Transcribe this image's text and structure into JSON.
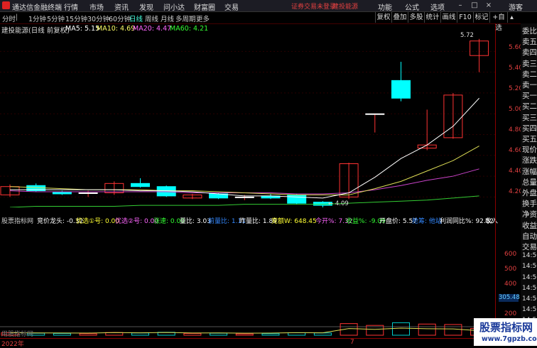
{
  "app": {
    "title": "通达信金融终端",
    "menus": [
      "行情",
      "市场",
      "资讯",
      "发现",
      "问小达",
      "财富圈",
      "交易"
    ],
    "warning": "证券交易未登录",
    "stock_link": "建投能源",
    "right_menus": [
      "功能",
      "公式",
      "选项"
    ],
    "guest": "游客"
  },
  "period_tabs": [
    "分时",
    "1分钟",
    "5分钟",
    "15分钟",
    "30分钟",
    "60分钟",
    "日线",
    "周线",
    "月线",
    "多周期",
    "更多"
  ],
  "active_tab": "日线",
  "toolbar": [
    "复权",
    "叠加",
    "多股",
    "统计",
    "画线",
    "F10",
    "标记",
    "+自选"
  ],
  "chart_info": {
    "name": "建投能源(日线 前复权)",
    "ma": [
      {
        "label": "MA5: 5.15",
        "color": "#ffffff"
      },
      {
        "label": "MA10: 4.69",
        "color": "#ffff66"
      },
      {
        "label": "MA20: 4.47",
        "color": "#ff66ff"
      },
      {
        "label": "MA60: 4.21",
        "color": "#33ff33"
      }
    ]
  },
  "price_axis": [
    "5.60",
    "5.40",
    "5.20",
    "5.00",
    "4.80",
    "4.60",
    "4.40",
    "4.20"
  ],
  "volume_axis": [
    "600",
    "500",
    "400",
    "305.48",
    "200",
    "100"
  ],
  "annotations": {
    "high": "5.72",
    "low": "4.09"
  },
  "indicator_bar": [
    {
      "label": "股票指标网",
      "color": "#cccccc"
    },
    {
      "label": "竞价龙头: -0.32",
      "color": "#ffffff"
    },
    {
      "label": "优选①号: 0.00",
      "color": "#ffff33"
    },
    {
      "label": "优选②号: 0.00",
      "color": "#ff66ff"
    },
    {
      "label": "涨速: 0.00",
      "color": "#33ff33"
    },
    {
      "label": "量比: 3.03",
      "color": "#ffffff"
    },
    {
      "label": "前量比: 1.11",
      "color": "#3388ff"
    },
    {
      "label": "昨量比: 1.89",
      "color": "#ffffff"
    },
    {
      "label": "竞额W: 648.45",
      "color": "#ffff33"
    },
    {
      "label": "今开%: 7.32",
      "color": "#ff66ff"
    },
    {
      "label": "收益%: -9.09",
      "color": "#33ff33"
    },
    {
      "label": "开盘价: 5.57",
      "color": "#ffffff"
    },
    {
      "label": "抢筹: 他站",
      "color": "#3388ff"
    },
    {
      "label": "利润同比%: 92.52",
      "color": "#ffffff"
    },
    {
      "label": "收入",
      "color": "#ffffff"
    }
  ],
  "side_panel": [
    "委比",
    "卖五",
    "卖四",
    "卖三",
    "卖二",
    "卖一",
    "买一",
    "买二",
    "买三",
    "买四",
    "买五",
    "现价",
    "涨跌",
    "涨幅",
    "总量",
    "外盘",
    "换手",
    "净资",
    "收益",
    "自动",
    "交易",
    "14:50",
    "14:50",
    "14:50",
    "14:50",
    "14:50",
    "14:56",
    "14:56",
    "14:56"
  ],
  "time_axis": {
    "year": "2022年",
    "month": "7"
  },
  "watermark": {
    "left": "用股指标网",
    "title": "股票指标网",
    "url": "www.7gpzb.com"
  },
  "chart_data": {
    "type": "candlestick",
    "ylim": [
      4.1,
      5.78
    ],
    "candles": [
      {
        "open": 4.22,
        "close": 4.3,
        "high": 4.32,
        "low": 4.2,
        "vol": 110
      },
      {
        "open": 4.31,
        "close": 4.26,
        "high": 4.33,
        "low": 4.25,
        "vol": 90
      },
      {
        "open": 4.25,
        "close": 4.23,
        "high": 4.26,
        "low": 4.22,
        "vol": 80
      },
      {
        "open": 4.24,
        "close": 4.24,
        "high": 4.26,
        "low": 4.2,
        "vol": 70
      },
      {
        "open": 4.24,
        "close": 4.33,
        "high": 4.35,
        "low": 4.22,
        "vol": 120
      },
      {
        "open": 4.33,
        "close": 4.3,
        "high": 4.38,
        "low": 4.29,
        "vol": 100
      },
      {
        "open": 4.3,
        "close": 4.21,
        "high": 4.31,
        "low": 4.2,
        "vol": 130
      },
      {
        "open": 4.19,
        "close": 4.22,
        "high": 4.23,
        "low": 4.18,
        "vol": 80
      },
      {
        "open": 4.23,
        "close": 4.19,
        "high": 4.24,
        "low": 4.18,
        "vol": 90
      },
      {
        "open": 4.2,
        "close": 4.2,
        "high": 4.22,
        "low": 4.17,
        "vol": 60
      },
      {
        "open": 4.21,
        "close": 4.19,
        "high": 4.23,
        "low": 4.18,
        "vol": 70
      },
      {
        "open": 4.22,
        "close": 4.14,
        "high": 4.23,
        "low": 4.13,
        "vol": 110
      },
      {
        "open": 4.15,
        "close": 4.12,
        "high": 4.16,
        "low": 4.09,
        "vol": 100
      },
      {
        "open": 4.2,
        "close": 4.52,
        "high": 4.53,
        "low": 4.18,
        "vol": 520
      },
      {
        "open": 5.0,
        "close": 5.0,
        "high": 5.0,
        "low": 4.82,
        "vol": 440
      },
      {
        "open": 5.32,
        "close": 5.15,
        "high": 5.5,
        "low": 5.12,
        "vol": 560
      },
      {
        "open": 4.67,
        "close": 4.7,
        "high": 5.04,
        "low": 4.65,
        "vol": 500
      },
      {
        "open": 4.77,
        "close": 5.18,
        "high": 5.2,
        "low": 4.76,
        "vol": 480
      },
      {
        "open": 5.56,
        "close": 5.7,
        "high": 5.72,
        "low": 5.4,
        "vol": 305
      }
    ],
    "ma5": [
      4.27,
      4.27,
      4.27,
      4.27,
      4.27,
      4.26,
      4.26,
      4.25,
      4.23,
      4.21,
      4.21,
      4.2,
      4.19,
      4.24,
      4.39,
      4.57,
      4.7,
      4.88,
      5.15
    ],
    "ma10": [
      4.3,
      4.29,
      4.28,
      4.27,
      4.27,
      4.27,
      4.26,
      4.26,
      4.25,
      4.24,
      4.23,
      4.22,
      4.22,
      4.22,
      4.28,
      4.35,
      4.45,
      4.55,
      4.69
    ],
    "ma20": [
      4.26,
      4.25,
      4.25,
      4.25,
      4.25,
      4.25,
      4.25,
      4.24,
      4.24,
      4.24,
      4.24,
      4.23,
      4.23,
      4.24,
      4.27,
      4.31,
      4.36,
      4.4,
      4.47
    ],
    "ma60": [
      4.1,
      4.11,
      4.11,
      4.11,
      4.11,
      4.12,
      4.12,
      4.12,
      4.12,
      4.13,
      4.13,
      4.13,
      4.13,
      4.14,
      4.15,
      4.16,
      4.17,
      4.19,
      4.21
    ]
  }
}
